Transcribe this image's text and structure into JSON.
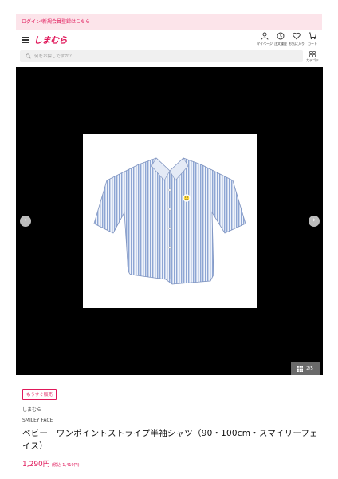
{
  "login_bar": {
    "text": "ログイン/新規会員登録はこちら"
  },
  "header": {
    "logo": "しまむら",
    "icons": [
      {
        "name": "user-icon",
        "label": "マイページ"
      },
      {
        "name": "clock-icon",
        "label": "注文履歴"
      },
      {
        "name": "heart-icon",
        "label": "お気に入り"
      },
      {
        "name": "cart-icon",
        "label": "カート"
      }
    ]
  },
  "search": {
    "placeholder": "何をお探しですか？",
    "category_label": "カテゴリ"
  },
  "gallery": {
    "counter": "2/5",
    "prev_icon": "chevron-left-icon",
    "next_icon": "chevron-right-icon"
  },
  "product": {
    "badge": "もうすぐ販売",
    "brand": "しまむら",
    "sub_brand": "SMILEY FACE",
    "title": "ベビー　ワンポイントストライプ半袖シャツ（90・100cm・スマイリーフェイス）",
    "price": "1,290円",
    "tax_price": "(税込 1,419円)"
  },
  "colors": {
    "accent": "#e0185a",
    "login_bg": "#fce4ea",
    "shirt_stripe": "#8ea6d4"
  }
}
